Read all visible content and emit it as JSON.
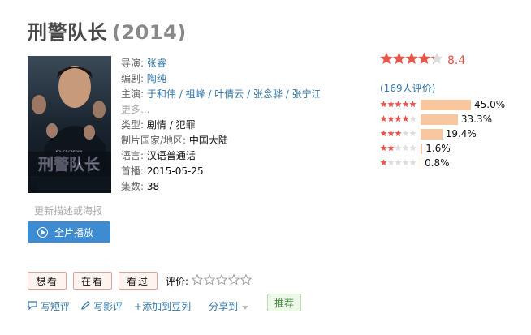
{
  "title": {
    "name": "刑警队长",
    "year": "(2014)"
  },
  "poster": {
    "caption": "刑警队长",
    "subcaption": "POLICE CAPTAIN"
  },
  "info": {
    "director_label": "导演:",
    "director": "张睿",
    "writer_label": "编剧:",
    "writer": "陶纯",
    "cast_label": "主演:",
    "cast": [
      "于和伟",
      "祖峰",
      "叶倩云",
      "张念骅",
      "张宁江"
    ],
    "cast_more": "更多...",
    "genre_label": "类型:",
    "genre": [
      "剧情",
      "犯罪"
    ],
    "country_label": "制片国家/地区:",
    "country": "中国大陆",
    "language_label": "语言:",
    "language": "汉语普通话",
    "premiere_label": "首播:",
    "premiere": "2015-05-25",
    "episodes_label": "集数:",
    "episodes": "38"
  },
  "update_link": "更新描述或海报",
  "play_button": "全片播放",
  "rating": {
    "score": "8.4",
    "stars_fraction": 0.85,
    "votes": "(169人评价)",
    "distribution": [
      {
        "stars": 5,
        "pct": "45.0%",
        "value": 45.0
      },
      {
        "stars": 4,
        "pct": "33.3%",
        "value": 33.3
      },
      {
        "stars": 3,
        "pct": "19.4%",
        "value": 19.4
      },
      {
        "stars": 2,
        "pct": "1.6%",
        "value": 1.6
      },
      {
        "stars": 1,
        "pct": "0.8%",
        "value": 0.8
      }
    ]
  },
  "actions": {
    "want": "想看",
    "watching": "在看",
    "watched": "看过",
    "rate_label": "评价:"
  },
  "bottom": {
    "short_review": "写短评",
    "review": "写影评",
    "add_doulist": "+添加到豆列",
    "share": "分享到",
    "recommend": "推荐"
  },
  "colors": {
    "link": "#3377aa",
    "star": "#e09015",
    "score": "#e8554b",
    "bar": "#f8c79f",
    "play": "#3d8bd0"
  }
}
